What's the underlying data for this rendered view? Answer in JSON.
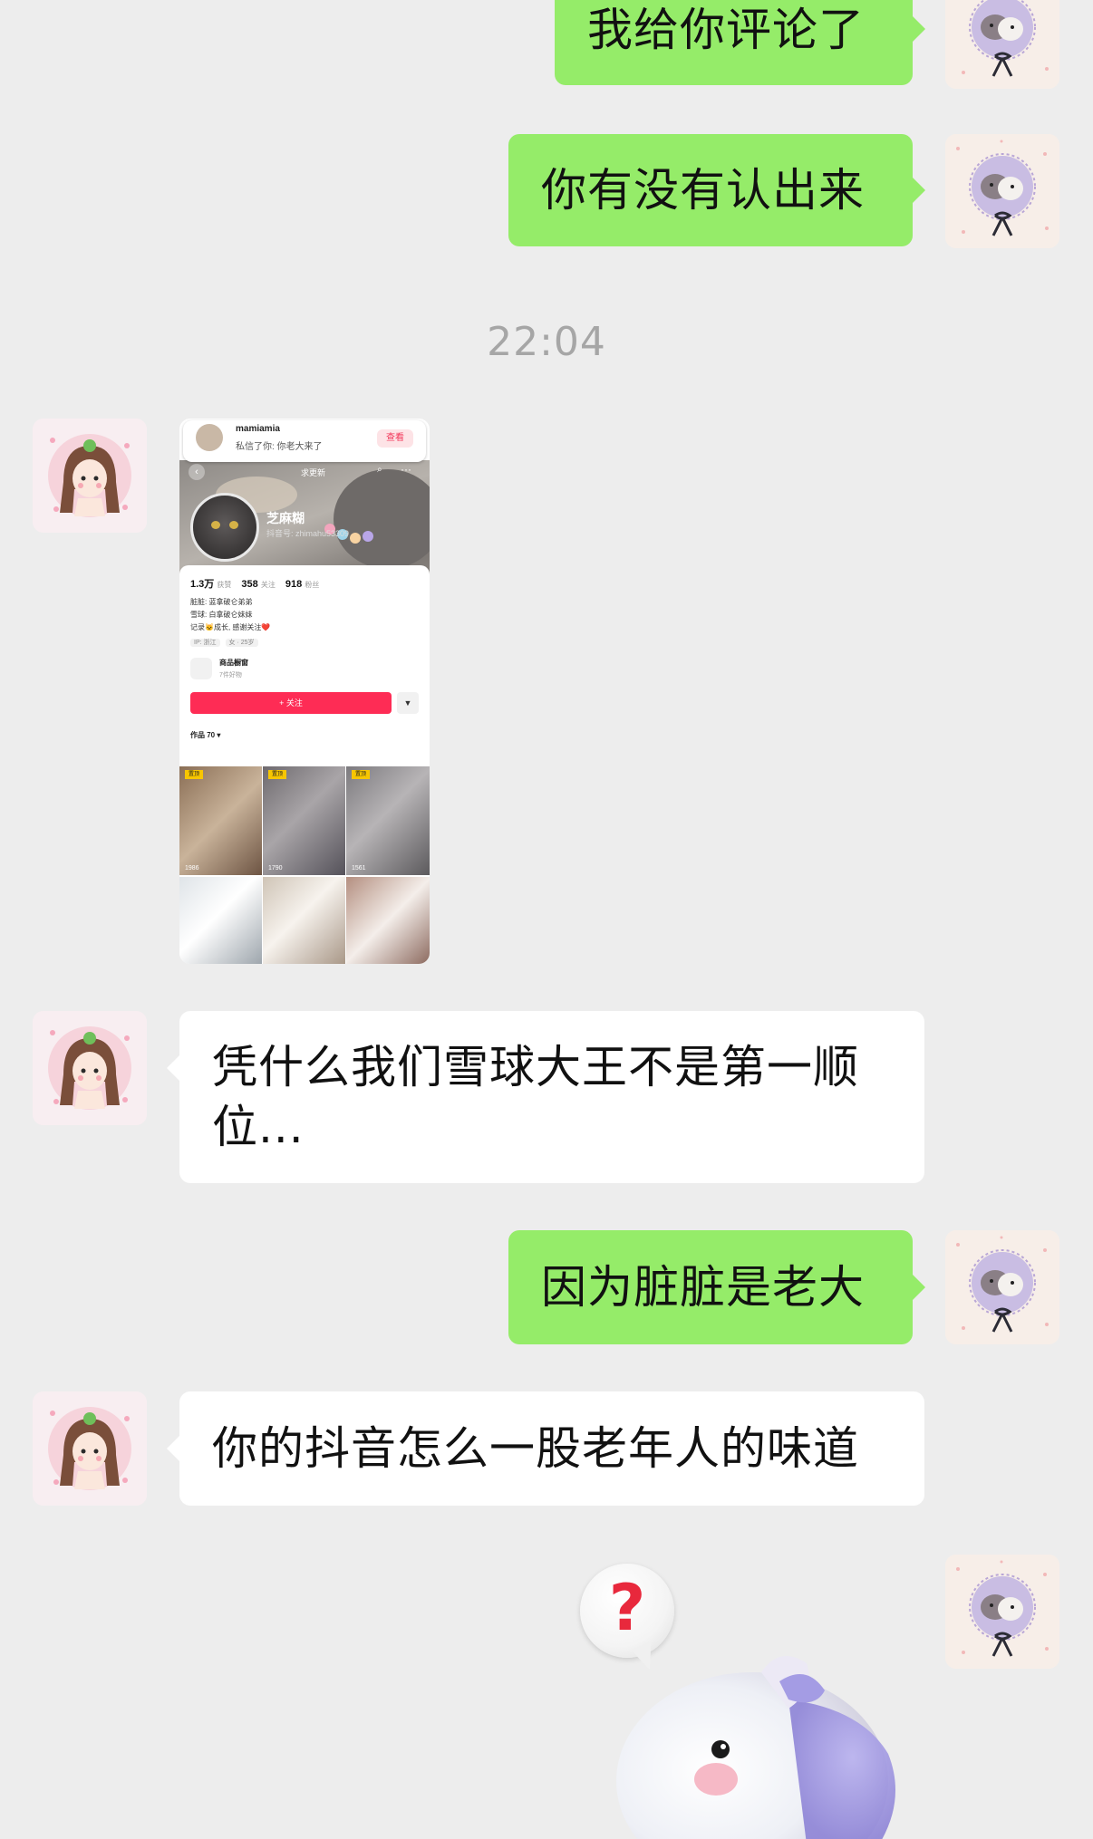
{
  "messages": {
    "m1": {
      "text": "我给你评论了"
    },
    "m2": {
      "text": "你有没有认出来"
    },
    "time": "22:04",
    "m4": {
      "text": "凭什么我们雪球大王不是第一顺位..."
    },
    "m5": {
      "text": "因为脏脏是老大"
    },
    "m6": {
      "text": "你的抖音怎么一股老年人的味道"
    }
  },
  "screenshot": {
    "notification": {
      "name": "mamiamia",
      "message": "私信了你: 你老大来了",
      "button": "查看"
    },
    "profile": {
      "name": "芝麻糊",
      "id": "抖音号: zhimahu53309",
      "top_action": "求更新",
      "stats": [
        {
          "value": "1.3万",
          "label": "获赞"
        },
        {
          "value": "358",
          "label": "关注"
        },
        {
          "value": "918",
          "label": "粉丝"
        }
      ],
      "bio": [
        "脏脏: 蓝拿破仑弟弟",
        "雪球: 白拿破仑妹妹",
        "记录🐱成长, 感谢关注❤️"
      ],
      "tags": [
        "IP: 浙江",
        "女 · 25岁"
      ],
      "shop_label": "商品橱窗",
      "shop_sub": "7件好物",
      "follow_button": "+ 关注",
      "works_label": "作品 70 ▾",
      "pin_label": "置顶",
      "likes": [
        "1986",
        "1790",
        "1561"
      ]
    }
  },
  "sticker": {
    "icon": "question-mark-bubble",
    "character": "purple-white-plush"
  }
}
